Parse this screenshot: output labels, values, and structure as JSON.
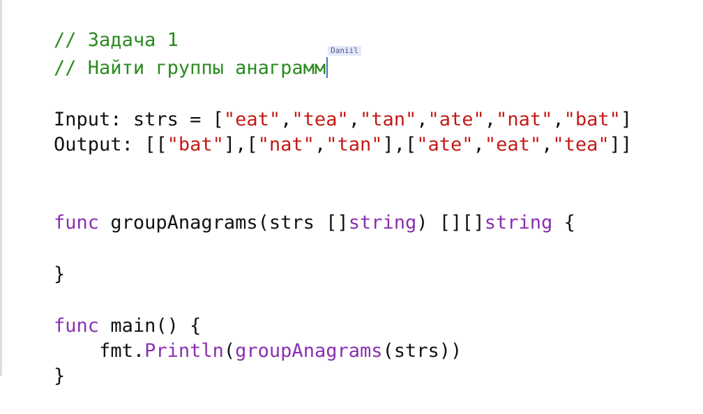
{
  "editor": {
    "lines": [
      {
        "comment": "// Задача 1"
      },
      {
        "comment": "// Найти группы анаграмм",
        "cursor_user": "Daniil"
      },
      {
        "blank": ""
      },
      {
        "input_label": "Input: strs = [",
        "strs": [
          "\"eat\"",
          "\"tea\"",
          "\"tan\"",
          "\"ate\"",
          "\"nat\"",
          "\"bat\""
        ],
        "close": "]"
      },
      {
        "output_label": "Output: [[",
        "groups": [
          [
            "\"bat\""
          ],
          [
            "\"nat\"",
            "\"tan\""
          ],
          [
            "\"ate\"",
            "\"eat\"",
            "\"tea\""
          ]
        ]
      },
      {
        "func_kw": "func",
        "func_sig": " groupAnagrams(strs []",
        "string_type": "string",
        "ret": ") [][]",
        "string_type2": "string",
        "open": " {"
      },
      {
        "close_brace": "}"
      },
      {
        "func_kw": "func",
        "main_sig": " main() {"
      },
      {
        "indent": "    ",
        "pkg": "fmt.",
        "call": "Println",
        "args_open": "(",
        "inner_call": "groupAnagrams",
        "args_rest": "(strs))"
      },
      {
        "close_brace": "}"
      }
    ],
    "comma": ",",
    "group_sep": "],[",
    "group_close": "]]"
  },
  "colors": {
    "comment": "#2a8a1f",
    "string": "#c41a16",
    "keyword": "#8a2fb0",
    "plain": "#111111",
    "cursor": "#4a6fd4"
  }
}
